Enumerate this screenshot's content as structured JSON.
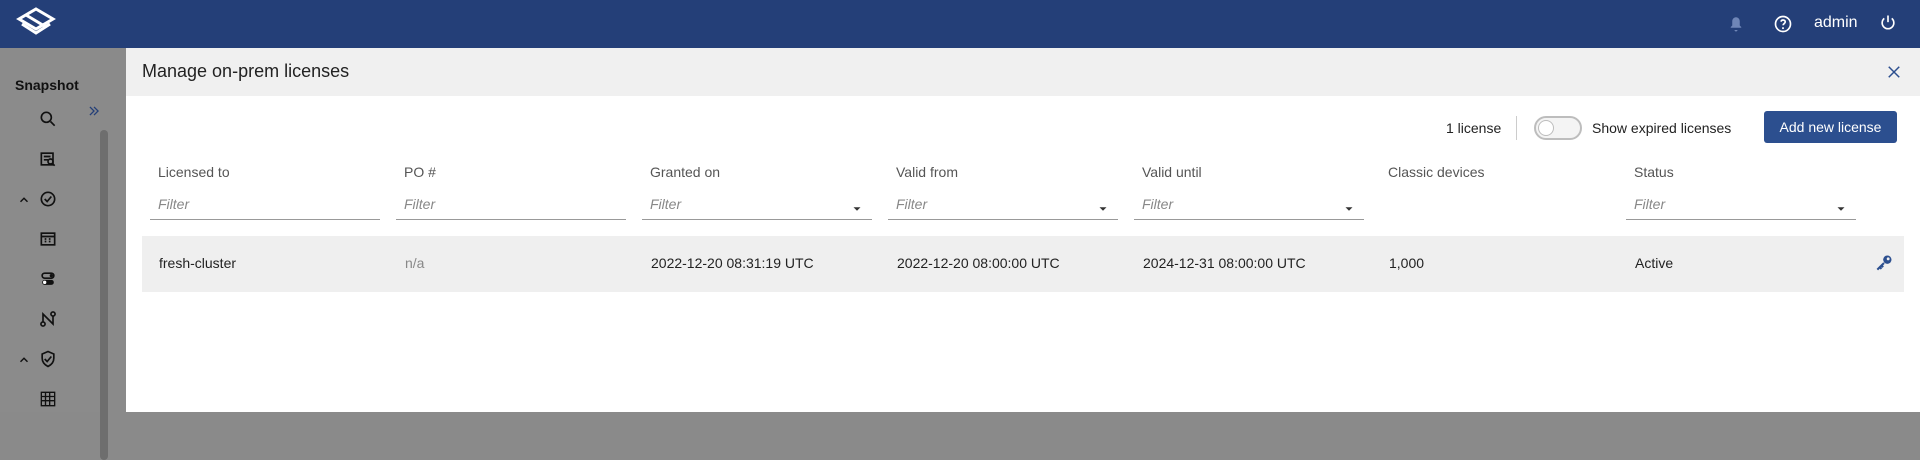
{
  "topbar": {
    "user": "admin",
    "icons": [
      "logo-icon",
      "bell-icon",
      "help-icon",
      "power-icon"
    ]
  },
  "sidebar": {
    "title": "Snapshot",
    "icons": [
      "search-icon",
      "search-list-icon",
      "collapse-icon",
      "check-circle-icon",
      "table-icon",
      "toggle-icon",
      "graph-icon",
      "collapse-icon",
      "shield-check-icon",
      "grid-icon"
    ]
  },
  "modal": {
    "title": "Manage on-prem licenses",
    "count_label": "1 license",
    "toggle_label": "Show expired licenses",
    "add_button": "Add new license"
  },
  "table": {
    "headers": [
      "Licensed to",
      "PO #",
      "Granted on",
      "Valid from",
      "Valid until",
      "Classic devices",
      "Status"
    ],
    "filter_placeholder": "Filter",
    "rows": [
      {
        "licensed_to": "fresh-cluster",
        "po": "n/a",
        "granted_on": "2022-12-20  08:31:19 UTC",
        "valid_from": "2022-12-20  08:00:00 UTC",
        "valid_until": "2024-12-31  08:00:00 UTC",
        "classic_devices": "1,000",
        "status": "Active"
      }
    ]
  },
  "colors": {
    "topbar": "#243f78",
    "primary_button": "#2c4f8f",
    "row_bg": "#efefef",
    "sidebar_bg": "#8b8b8b"
  }
}
